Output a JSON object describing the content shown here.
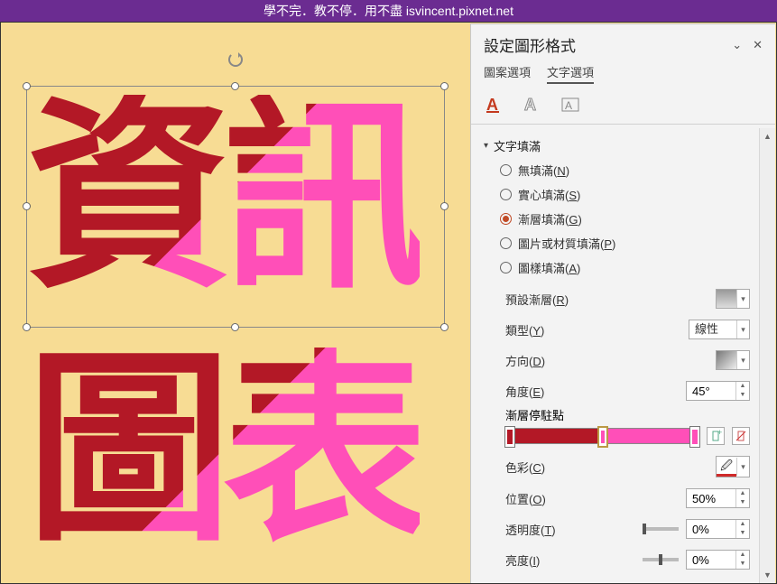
{
  "titlebar": "學不完．教不停．用不盡 isvincent.pixnet.net",
  "text": {
    "row1": "資訊",
    "row2": "圖表"
  },
  "panel": {
    "title": "設定圖形格式",
    "tabs": {
      "shape": "圖案選項",
      "text": "文字選項"
    }
  },
  "section": {
    "textFill": "文字填滿"
  },
  "fill": {
    "none": "無填滿(N)",
    "solid": "實心填滿(S)",
    "gradient": "漸層填滿(G)",
    "picture": "圖片或材質填滿(P)",
    "pattern": "圖樣填滿(A)"
  },
  "labels": {
    "preset": "預設漸層(R)",
    "type": "類型(Y)",
    "typeValue": "線性",
    "direction": "方向(D)",
    "angle": "角度(E)",
    "angleValue": "45°",
    "stops": "漸層停駐點",
    "color": "色彩(C)",
    "position": "位置(O)",
    "positionValue": "50%",
    "transparency": "透明度(T)",
    "transparencyValue": "0%",
    "brightness": "亮度(I)",
    "brightnessValue": "0%"
  }
}
